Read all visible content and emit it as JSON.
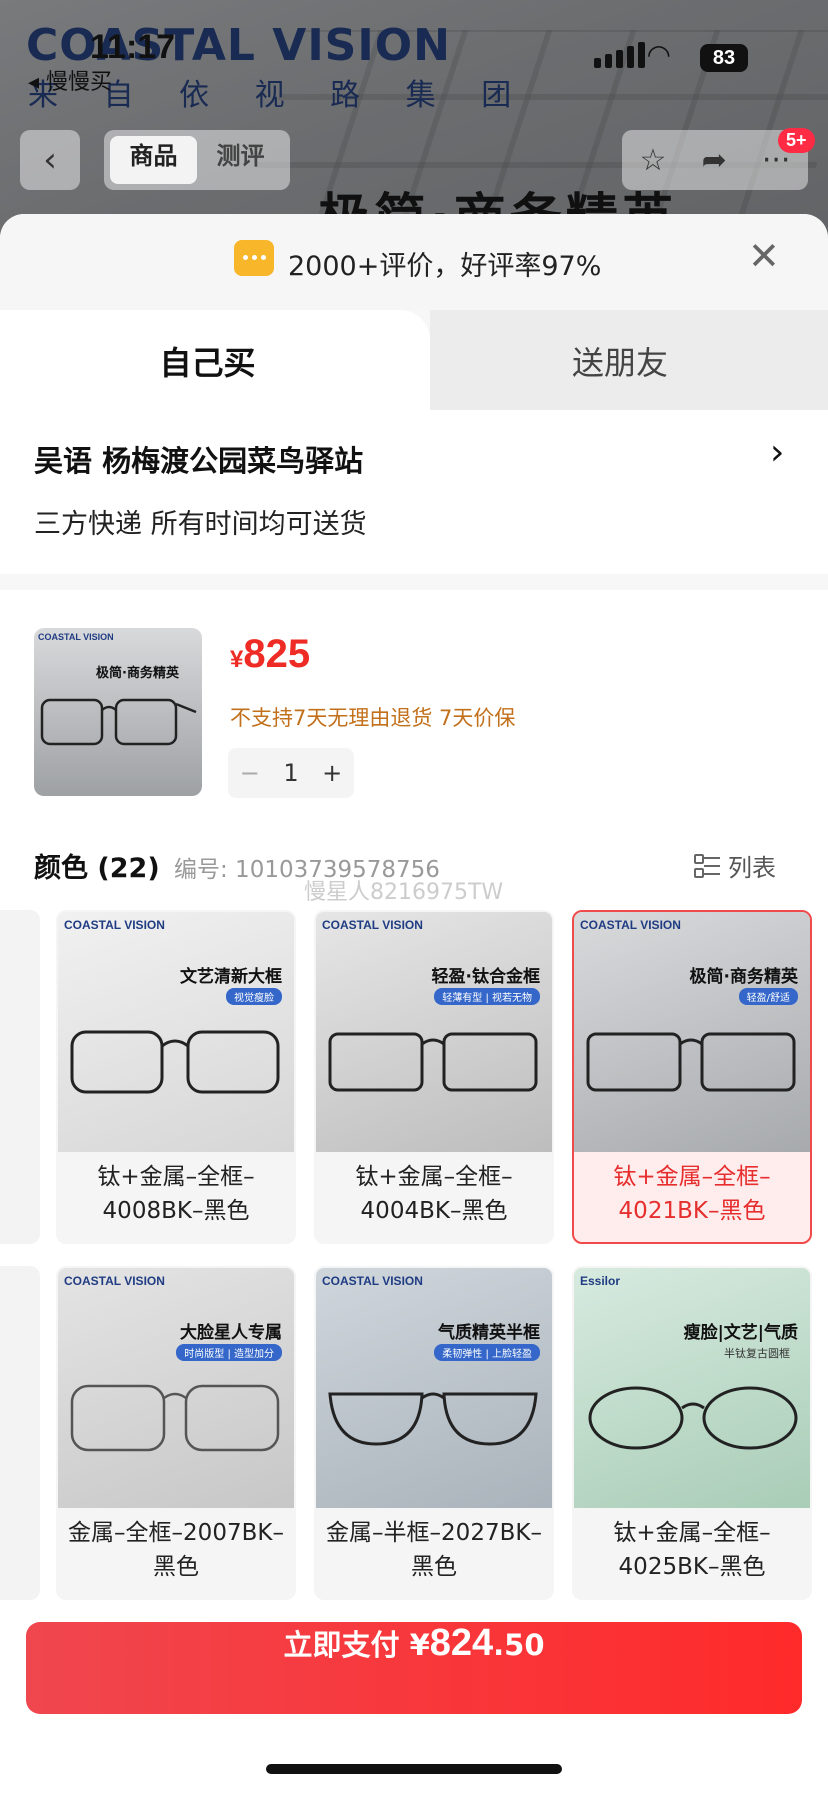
{
  "background": {
    "brand_en": "COASTAL VISION",
    "brand_cn": "来 自 依 视 路 集 团",
    "hero_text": "极简·商务精英"
  },
  "status_bar": {
    "time": "11:17",
    "back_app": "◂ 慢慢买",
    "battery": "83"
  },
  "nav": {
    "tab_goods": "商品",
    "tab_review": "测评",
    "badge": "5+"
  },
  "rating": {
    "text": "2000+评价，好评率97%"
  },
  "tabs": {
    "self": "自己买",
    "friend": "送朋友"
  },
  "address": {
    "line1": "吴语  杨梅渡公园菜鸟驿站",
    "line2": "三方快递 所有时间均可送货"
  },
  "product": {
    "thumb_brand": "COASTAL VISION",
    "thumb_title": "极简·商务精英",
    "currency": "¥",
    "price": "825",
    "notes": "不支持7天无理由退货   7天价保",
    "quantity": "1",
    "color_title": "颜色 (22)",
    "code_label": "编号: 10103739578756",
    "list_label": "列表",
    "watermark": "慢星人8216975TW"
  },
  "variants": [
    {
      "brand": "COASTAL VISION",
      "tagline": "文艺清新大框",
      "sub": "视觉瘦脸",
      "label": "钛+金属–全框–4008BK–黑色",
      "selected": false
    },
    {
      "brand": "COASTAL VISION",
      "tagline": "轻盈·钛合金框",
      "sub": "轻薄有型 | 视若无物",
      "label": "钛+金属–全框–4004BK–黑色",
      "selected": false
    },
    {
      "brand": "COASTAL VISION",
      "tagline": "极简·商务精英",
      "sub": "轻盈/舒适",
      "label": "钛+金属–全框–4021BK–黑色",
      "selected": true
    },
    {
      "brand": "COASTAL VISION",
      "tagline": "大脸星人专属",
      "sub": "时尚版型 | 造型加分",
      "label": "金属–全框–2007BK–黑色",
      "selected": false
    },
    {
      "brand": "COASTAL VISION",
      "tagline": "气质精英半框",
      "sub": "柔韧弹性 | 上脸轻盈",
      "label": "金属–半框–2027BK–黑色",
      "selected": false
    },
    {
      "brand": "Essilor",
      "tagline": "瘦脸|文艺|气质",
      "sub": "半钛复古圆框",
      "label": "钛+金属–全框–4025BK–黑色",
      "selected": false
    }
  ],
  "pay": {
    "label": "立即支付 ",
    "currency": "¥",
    "amount": "824",
    "cents": ".50"
  },
  "colors": {
    "accent": "#ee2b24",
    "selected_border": "#f04a4a",
    "rating_icon": "#f8b62a"
  }
}
